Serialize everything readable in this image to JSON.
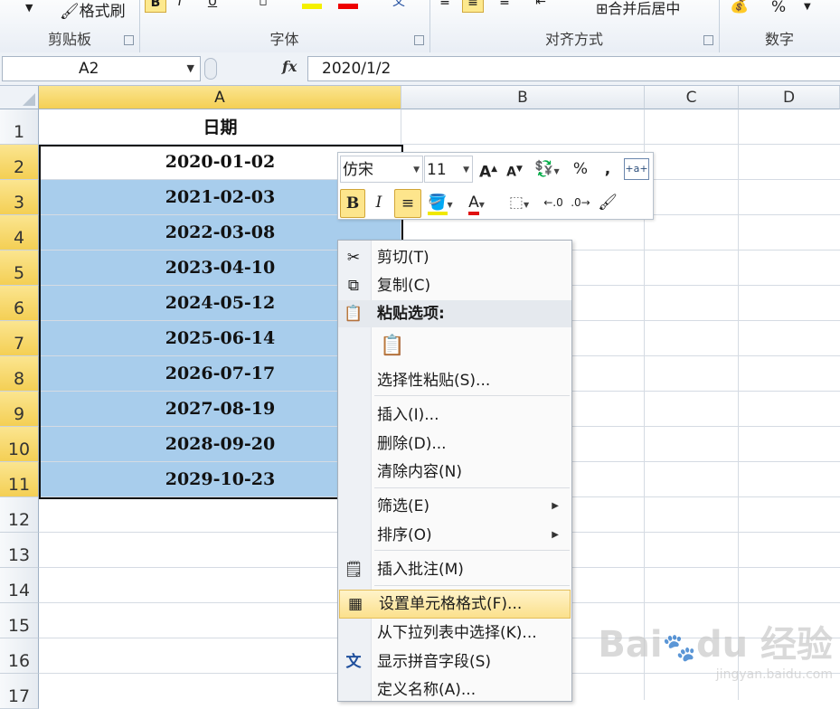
{
  "ribbon": {
    "format_painter": "格式刷",
    "groups": {
      "clipboard": "剪贴板",
      "font": "字体",
      "alignment": "对齐方式",
      "number": "数字"
    },
    "merge_center": "合并后居中",
    "percent": "%"
  },
  "formula_bar": {
    "name_box": "A2",
    "fx": "fx",
    "content": "2020/1/2"
  },
  "columns": [
    "A",
    "B",
    "C",
    "D"
  ],
  "rows": [
    "1",
    "2",
    "3",
    "4",
    "5",
    "6",
    "7",
    "8",
    "9",
    "10",
    "11",
    "12",
    "13",
    "14",
    "15",
    "16",
    "17"
  ],
  "cells": {
    "header": "日期",
    "dates": [
      "2020-01-02",
      "2021-02-03",
      "2022-03-08",
      "2023-04-10",
      "2024-05-12",
      "2025-06-14",
      "2026-07-17",
      "2027-08-19",
      "2028-09-20",
      "2029-10-23"
    ]
  },
  "mini_toolbar": {
    "font": "仿宋",
    "size": "11",
    "bold": "B",
    "italic": "I",
    "percent": "%",
    "comma": ",",
    "font_color_letter": "A"
  },
  "context_menu": {
    "cut": "剪切(T)",
    "copy": "复制(C)",
    "paste_options": "粘贴选项:",
    "paste_special": "选择性粘贴(S)...",
    "insert": "插入(I)...",
    "delete": "删除(D)...",
    "clear": "清除内容(N)",
    "filter": "筛选(E)",
    "sort": "排序(O)",
    "insert_comment": "插入批注(M)",
    "format_cells": "设置单元格格式(F)...",
    "pick_list": "从下拉列表中选择(K)...",
    "phonetic": "显示拼音字段(S)",
    "define_name": "定义名称(A)..."
  },
  "colors": {
    "selection_fill": "#a8cdec",
    "header_highlight": "#f4cf54",
    "hover": "#fbe08c"
  }
}
